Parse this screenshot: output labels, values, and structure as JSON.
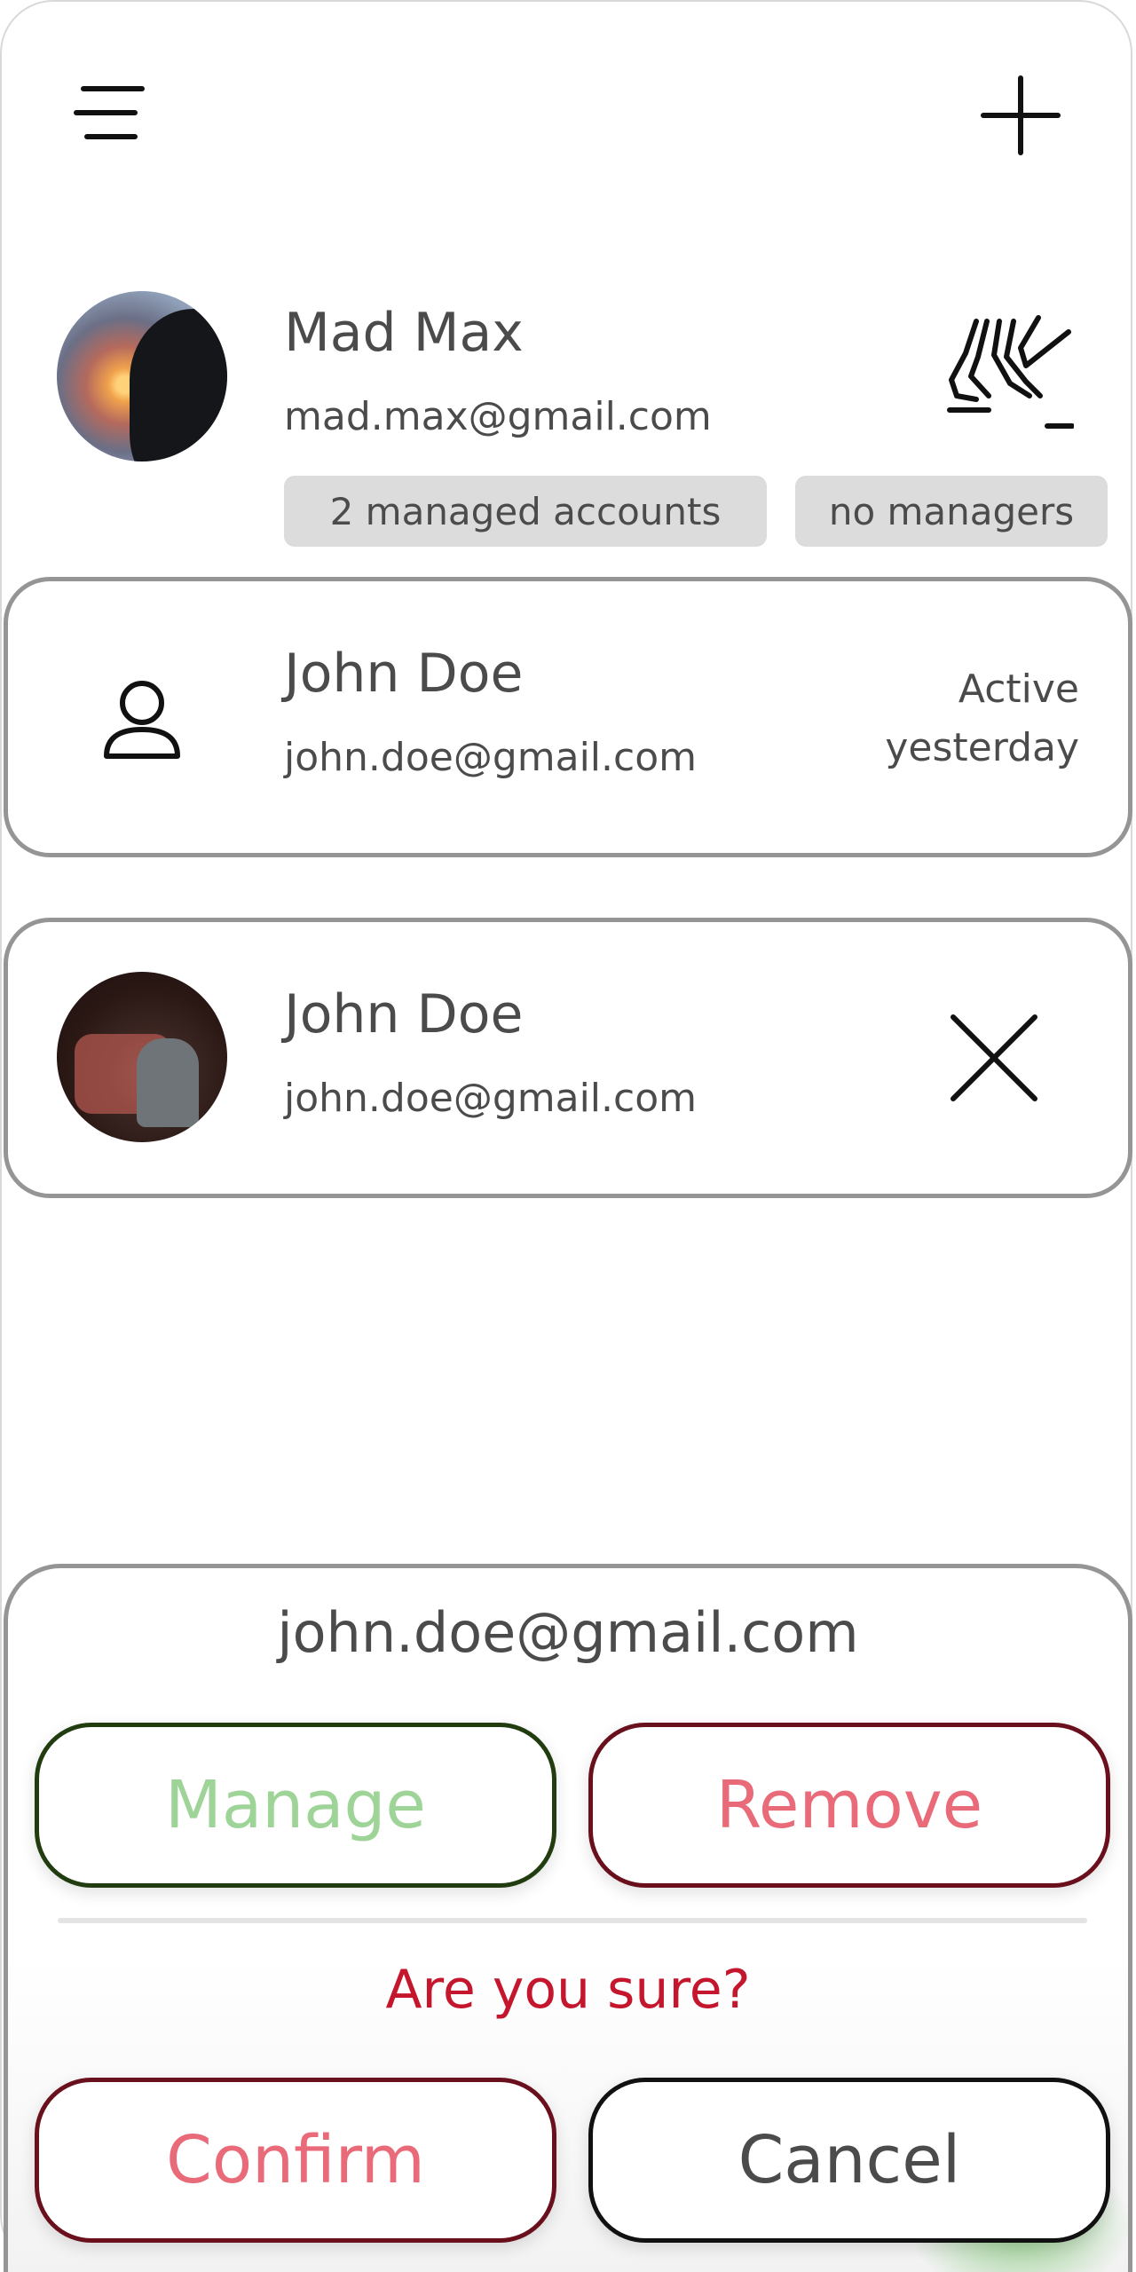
{
  "header": {
    "menu_icon": "menu-icon",
    "add_icon": "plus-icon"
  },
  "current_user": {
    "name": "Mad Max",
    "email": "mad.max@gmail.com",
    "badges": {
      "managed": "2 managed accounts",
      "managers": "no managers"
    },
    "icon": "skating-icon"
  },
  "accounts": [
    {
      "name": "John Doe",
      "email": "john.doe@gmail.com",
      "status_line1": "Active",
      "status_line2": "yesterday",
      "avatar_icon": "person-icon"
    },
    {
      "name": "John Doe",
      "email": "john.doe@gmail.com",
      "action_icon": "close-icon"
    }
  ],
  "sheet": {
    "email": "john.doe@gmail.com",
    "manage_label": "Manage",
    "remove_label": "Remove",
    "confirm_question": "Are you sure?",
    "confirm_label": "Confirm",
    "cancel_label": "Cancel"
  },
  "colors": {
    "card_border": "#959595",
    "manage_border": "#213d10",
    "manage_text": "#9ed497",
    "danger_border": "#6a0f1c",
    "danger_text": "#e96a79",
    "question_text": "#c4172d"
  }
}
